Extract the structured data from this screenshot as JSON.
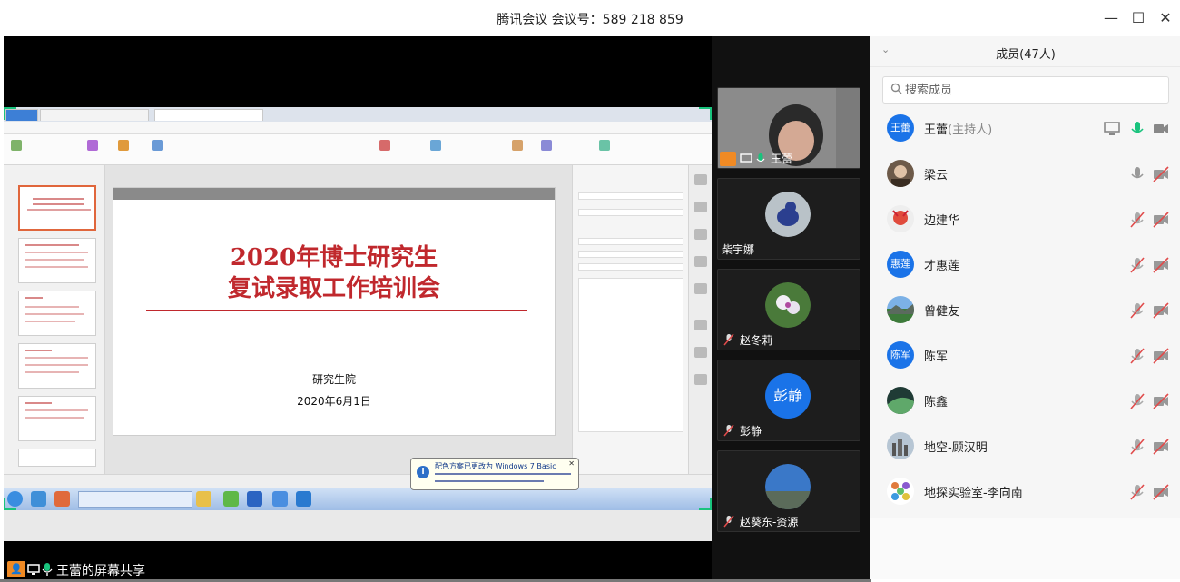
{
  "window": {
    "title": "腾讯会议 会议号：589 218 859",
    "minimize": "—",
    "maximize": "☐",
    "close": "✕"
  },
  "share": {
    "label": "王蕾的屏幕共享"
  },
  "slide": {
    "title_line1": "2020年博士研究生",
    "title_line2": "复试录取工作培训会",
    "org": "研究生院",
    "date": "2020年6月1日"
  },
  "balloon": {
    "title": "配色方案已更改为 Windows 7 Basic",
    "close": "✕",
    "icon": "i"
  },
  "video_tiles": [
    {
      "name": "王蕾",
      "kind": "camera",
      "mic": "on"
    },
    {
      "name": "柴宇娜",
      "kind": "avatar",
      "mic": "none"
    },
    {
      "name": "赵冬莉",
      "kind": "avatar",
      "mic": "muted"
    },
    {
      "name": "彭静",
      "kind": "text",
      "avatar_text": "彭静",
      "mic": "muted"
    },
    {
      "name": "赵葵东-资源",
      "kind": "avatar",
      "mic": "muted"
    }
  ],
  "panel": {
    "title": "成员(47人)",
    "collapse": "⌄",
    "search_placeholder": "搜索成员",
    "search_icon": "search-icon",
    "members": [
      {
        "name": "王蕾",
        "role": "(主持人)",
        "avatar_text": "王蕾",
        "mic": "on",
        "video": "on",
        "sharing": true
      },
      {
        "name": "梁云",
        "role": "",
        "avatar_text": "",
        "mic": "idle",
        "video": "off",
        "sharing": false
      },
      {
        "name": "边建华",
        "role": "",
        "avatar_text": "",
        "mic": "muted",
        "video": "off",
        "sharing": false
      },
      {
        "name": "才惠莲",
        "role": "",
        "avatar_text": "惠莲",
        "mic": "muted",
        "video": "off",
        "sharing": false
      },
      {
        "name": "曾健友",
        "role": "",
        "avatar_text": "",
        "mic": "muted",
        "video": "off",
        "sharing": false
      },
      {
        "name": "陈军",
        "role": "",
        "avatar_text": "陈军",
        "mic": "muted",
        "video": "off",
        "sharing": false
      },
      {
        "name": "陈鑫",
        "role": "",
        "avatar_text": "",
        "mic": "muted",
        "video": "off",
        "sharing": false
      },
      {
        "name": "地空-顾汉明",
        "role": "",
        "avatar_text": "",
        "mic": "muted",
        "video": "off",
        "sharing": false
      },
      {
        "name": "地探实验室-李向南",
        "role": "",
        "avatar_text": "",
        "mic": "muted",
        "video": "off",
        "sharing": false
      }
    ]
  },
  "colors": {
    "accent": "#1a73e8",
    "mic_on": "#19c37d",
    "muted": "#e04b4b",
    "slide_red": "#c0282d"
  }
}
